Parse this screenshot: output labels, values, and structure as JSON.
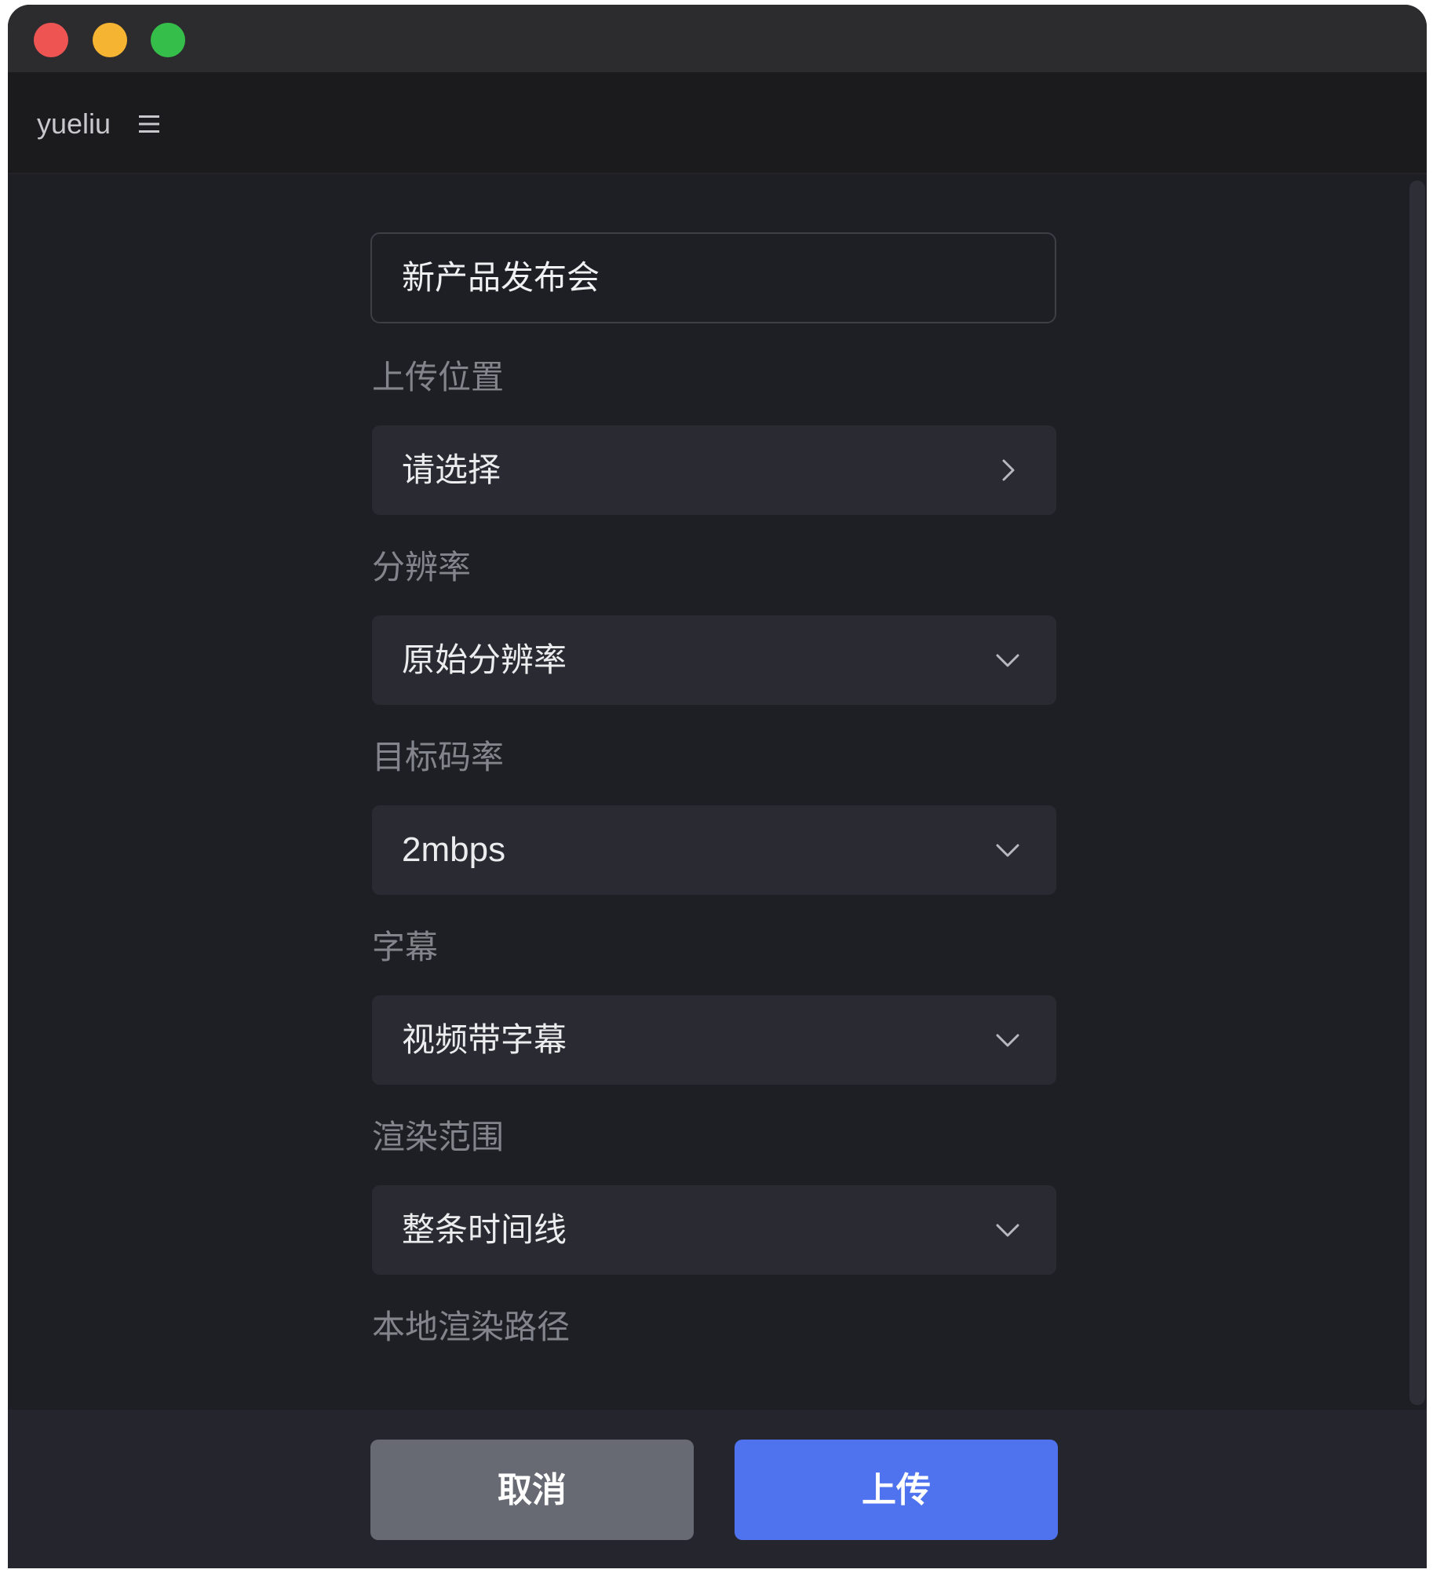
{
  "window": {
    "app_name": "yueliu"
  },
  "form": {
    "title_value": "新产品发布会",
    "fields": [
      {
        "label": "上传位置",
        "value": "请选择",
        "icon": "chevron-right-icon"
      },
      {
        "label": "分辨率",
        "value": "原始分辨率",
        "icon": "chevron-down-icon"
      },
      {
        "label": "目标码率",
        "value": "2mbps",
        "icon": "chevron-down-icon"
      },
      {
        "label": "字幕",
        "value": "视频带字幕",
        "icon": "chevron-down-icon"
      },
      {
        "label": "渲染范围",
        "value": "整条时间线",
        "icon": "chevron-down-icon"
      }
    ],
    "local_path_label": "本地渲染路径"
  },
  "footer": {
    "cancel_label": "取消",
    "upload_label": "上传"
  },
  "colors": {
    "background": "#1e1f25",
    "field_bg": "#2a2b32",
    "accent": "#4f73ee",
    "cancel_bg": "#676a73",
    "traffic_red": "#ee5452",
    "traffic_yellow": "#f5b431",
    "traffic_green": "#35be4a"
  }
}
